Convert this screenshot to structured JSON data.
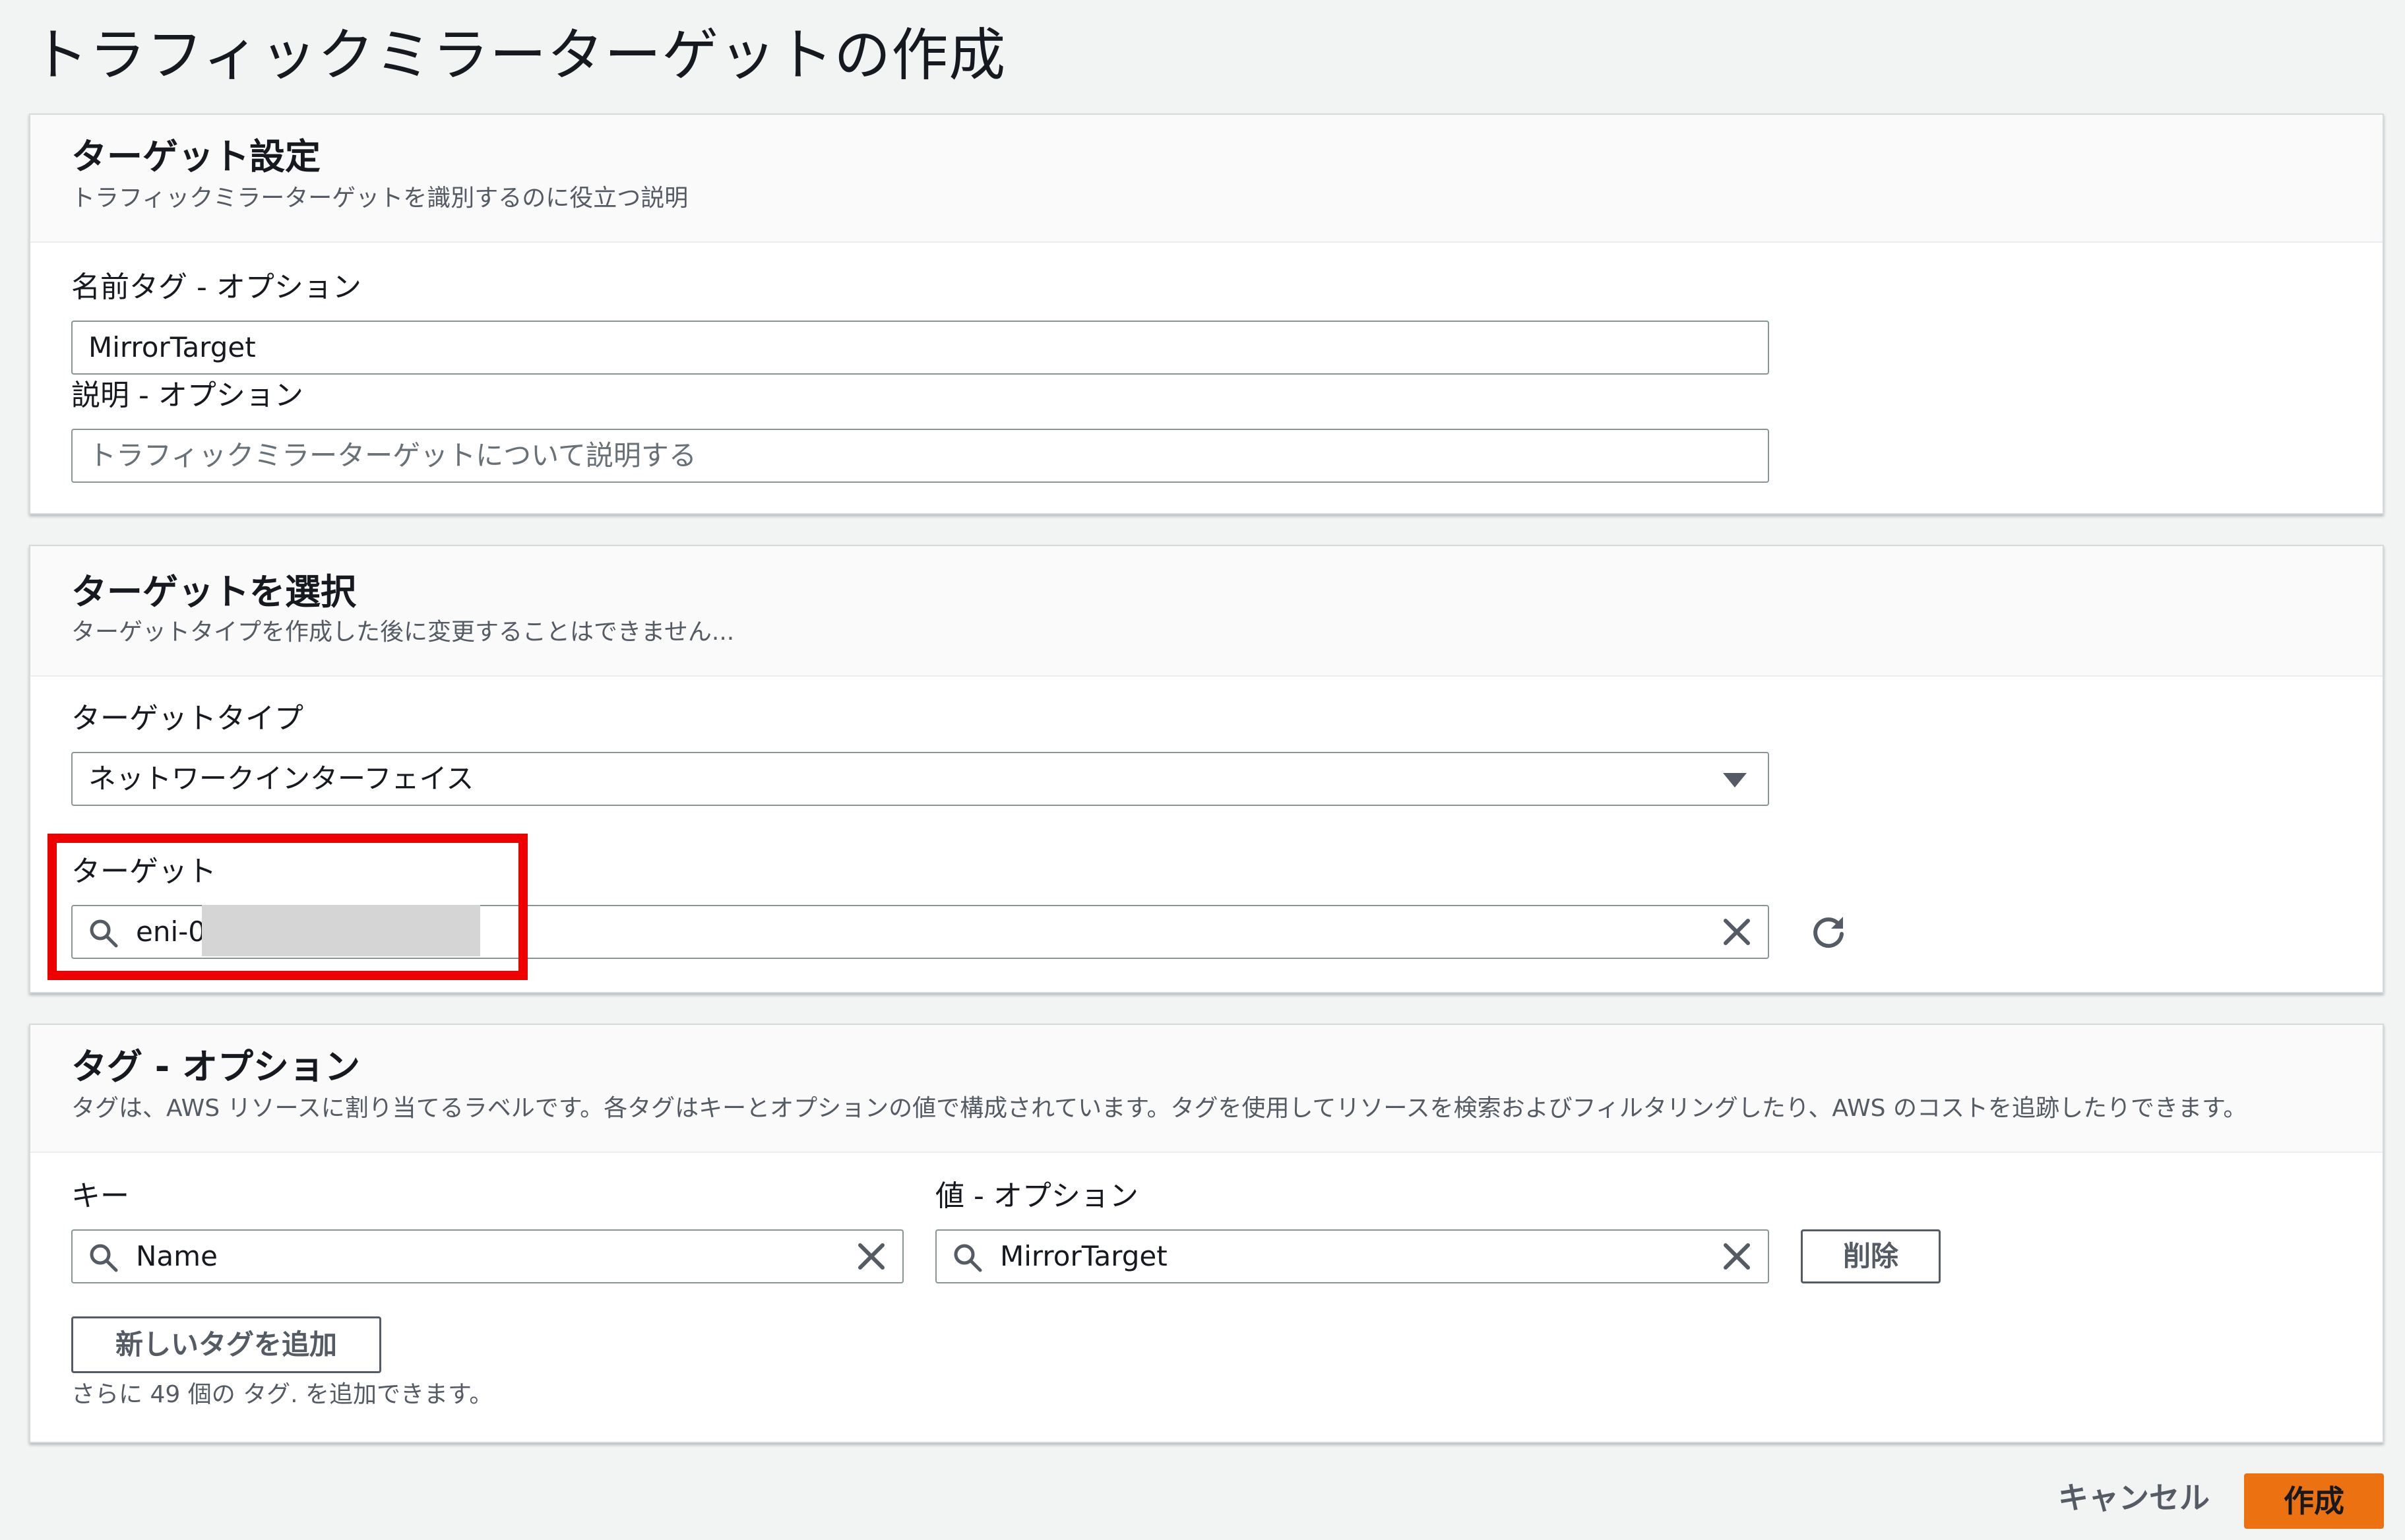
{
  "page": {
    "title": "トラフィックミラーターゲットの作成"
  },
  "target_settings": {
    "title": "ターゲット設定",
    "description": "トラフィックミラーターゲットを識別するのに役立つ説明",
    "name_label": "名前タグ - オプション",
    "name_value": "MirrorTarget",
    "description_label": "説明 - オプション",
    "description_placeholder": "トラフィックミラーターゲットについて説明する"
  },
  "target_select": {
    "title": "ターゲットを選択",
    "description": "ターゲットタイプを作成した後に変更することはできません...",
    "type_label": "ターゲットタイプ",
    "type_value": "ネットワークインターフェイス",
    "target_label": "ターゲット",
    "target_value": "eni-0"
  },
  "tags": {
    "title": "タグ - オプション",
    "description": "タグは、AWS リソースに割り当てるラベルです。各タグはキーとオプションの値で構成されています。タグを使用してリソースを検索およびフィルタリングしたり、AWS のコストを追跡したりできます。",
    "key_label": "キー",
    "value_label": "値 - オプション",
    "rows": [
      {
        "key": "Name",
        "value": "MirrorTarget",
        "remove_label": "削除"
      }
    ],
    "add_label": "新しいタグを追加",
    "remaining_hint": "さらに 49 個の タグ. を追加できます。"
  },
  "footer": {
    "cancel_label": "キャンセル",
    "create_label": "作成"
  },
  "colors": {
    "primary": "#ec7211",
    "highlight": "#ee0000",
    "background": "#f2f3f3"
  },
  "icons": {
    "search": "search-icon",
    "clear": "close-icon",
    "refresh": "refresh-icon",
    "dropdown": "caret-down-icon"
  }
}
